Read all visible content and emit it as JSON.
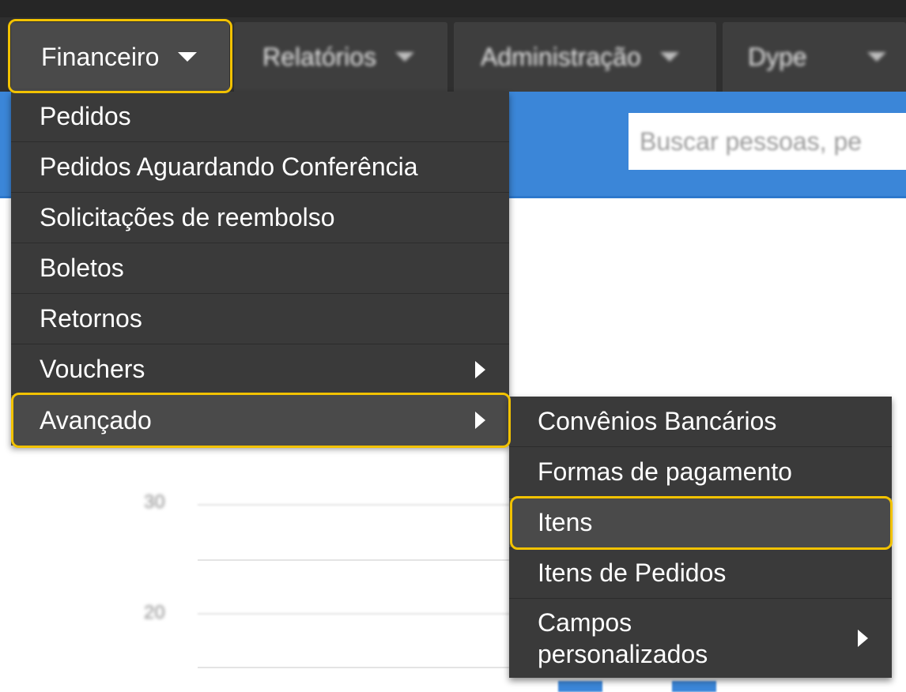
{
  "nav": {
    "tabs": [
      {
        "label": "Financeiro",
        "state": "open"
      },
      {
        "label": "Relatórios",
        "state": "blurred"
      },
      {
        "label": "Administração",
        "state": "blurred"
      },
      {
        "label": "Dype",
        "state": "blurred"
      }
    ]
  },
  "search": {
    "placeholder": "Buscar pessoas, pe"
  },
  "financeiro_menu": {
    "items": [
      {
        "label": "Pedidos",
        "has_submenu": false
      },
      {
        "label": "Pedidos Aguardando Conferência",
        "has_submenu": false
      },
      {
        "label": "Solicitações de reembolso",
        "has_submenu": false
      },
      {
        "label": "Boletos",
        "has_submenu": false
      },
      {
        "label": "Retornos",
        "has_submenu": false
      },
      {
        "label": "Vouchers",
        "has_submenu": true
      },
      {
        "label": "Avançado",
        "has_submenu": true,
        "state": "highlighted"
      }
    ]
  },
  "avancado_submenu": {
    "items": [
      {
        "label": "Convênios Bancários",
        "has_submenu": false
      },
      {
        "label": "Formas de pagamento",
        "has_submenu": false
      },
      {
        "label": "Itens",
        "has_submenu": false,
        "state": "highlighted"
      },
      {
        "label": "Itens de Pedidos",
        "has_submenu": false
      },
      {
        "label": "Campos personalizados",
        "has_submenu": true
      }
    ]
  },
  "background_chart": {
    "y_ticks": [
      "30",
      "20"
    ]
  },
  "colors": {
    "highlight_outline": "#f2c200",
    "menu_bg": "#3a3a3a",
    "menu_hover_bg": "#4a4a4a",
    "topbar_bg": "#2f2f2f",
    "blue_band": "#3b86d8"
  }
}
